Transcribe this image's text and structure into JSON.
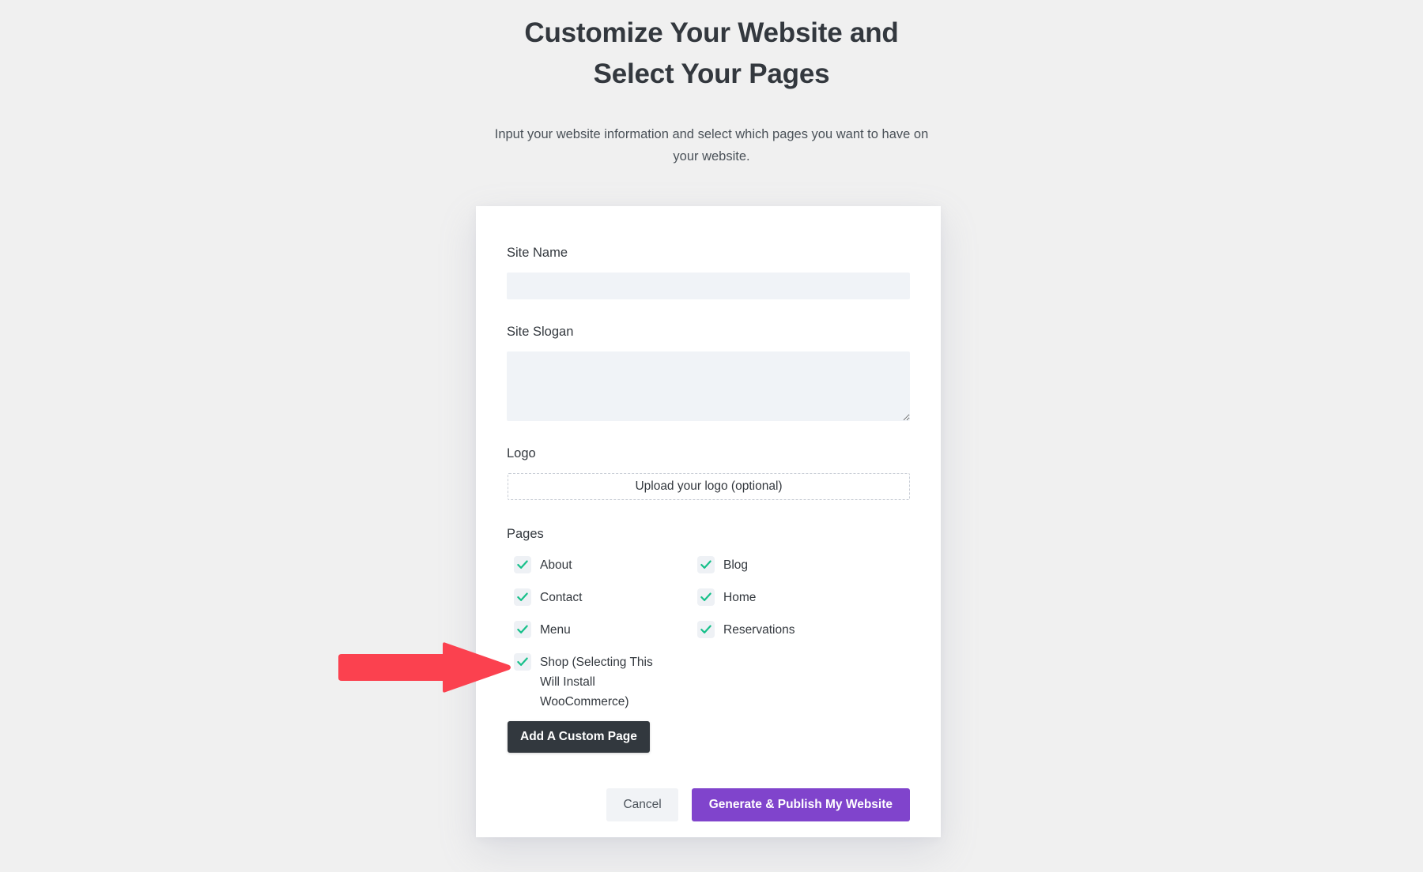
{
  "header": {
    "title": "Customize Your Website and Select Your Pages",
    "subtitle": "Input your website information and select which pages you want to have on your website."
  },
  "form": {
    "site_name": {
      "label": "Site Name",
      "value": "",
      "placeholder": ""
    },
    "site_slogan": {
      "label": "Site Slogan",
      "value": "",
      "placeholder": ""
    },
    "logo": {
      "label": "Logo",
      "dropzone_label": "Upload your logo (optional)"
    },
    "pages": {
      "label": "Pages",
      "options": [
        {
          "label": "About",
          "checked": true
        },
        {
          "label": "Blog",
          "checked": true
        },
        {
          "label": "Contact",
          "checked": true
        },
        {
          "label": "Home",
          "checked": true
        },
        {
          "label": "Menu",
          "checked": true
        },
        {
          "label": "Reservations",
          "checked": true
        },
        {
          "label": "Shop (Selecting This Will Install WooCommerce)",
          "checked": true
        }
      ]
    },
    "add_custom_page_label": "Add A Custom Page"
  },
  "footer": {
    "cancel_label": "Cancel",
    "generate_label": "Generate & Publish My Website"
  },
  "annotation": {
    "type": "arrow",
    "direction": "right",
    "points_to": "Shop (Selecting This Will Install WooCommerce)",
    "color": "#fb414f"
  },
  "colors": {
    "page_background": "#f0f0f0",
    "card_background": "#ffffff",
    "input_background": "#f0f3f7",
    "checkbox_background": "#eef1f5",
    "check_mark": "#17c08a",
    "primary_button": "#8044cc",
    "dark_button": "#32383e",
    "cancel_button": "#f1f3f6",
    "text": "#33383e",
    "annotation_arrow": "#fb414f"
  }
}
